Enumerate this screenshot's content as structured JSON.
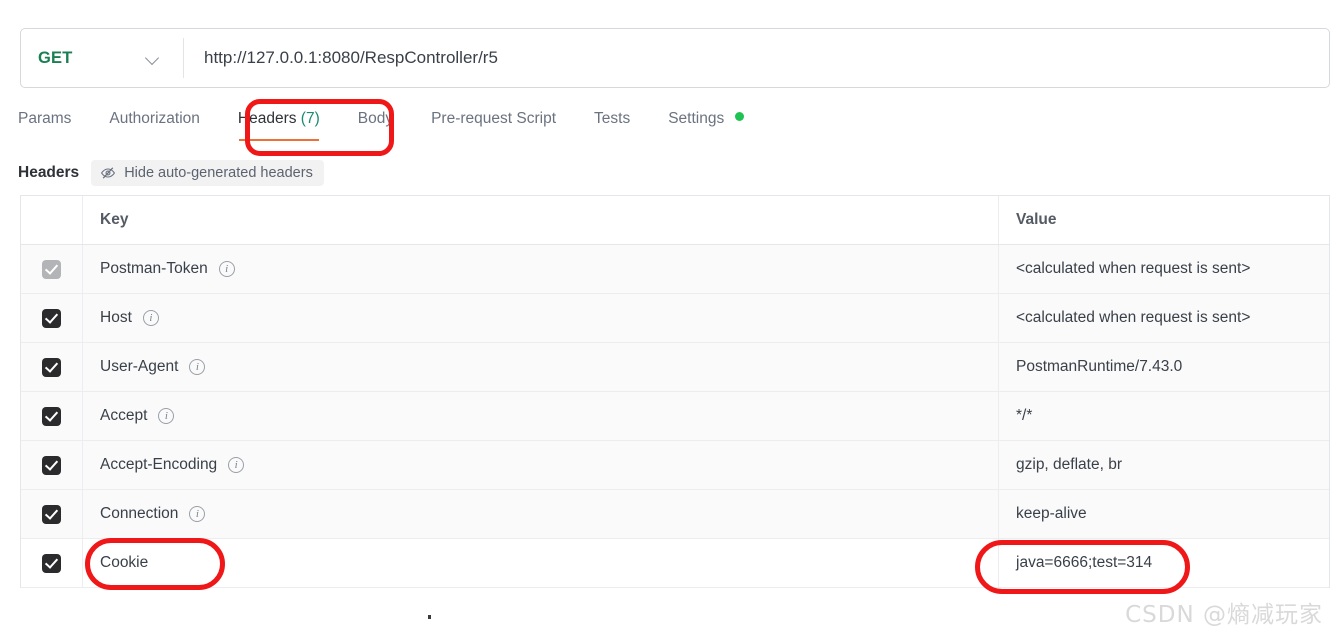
{
  "request_bar": {
    "method": "GET",
    "method_dropdown_icon": "chevron-down-icon",
    "url": "http://127.0.0.1:8080/RespController/r5"
  },
  "tabs": [
    {
      "label": "Params",
      "active": false
    },
    {
      "label": "Authorization",
      "active": false
    },
    {
      "label": "Headers",
      "count": "(7)",
      "active": true
    },
    {
      "label": "Body",
      "active": false
    },
    {
      "label": "Pre-request Script",
      "active": false
    },
    {
      "label": "Tests",
      "active": false
    },
    {
      "label": "Settings",
      "active": false,
      "dot": true
    }
  ],
  "subbar": {
    "title": "Headers",
    "hide_button_label": "Hide auto-generated headers",
    "hide_button_icon": "eye-slash-icon"
  },
  "table": {
    "columns": [
      "Key",
      "Value"
    ],
    "rows": [
      {
        "checked": true,
        "disabled": true,
        "auto_generated": true,
        "key": "Postman-Token",
        "has_info": true,
        "value": "<calculated when request is sent>"
      },
      {
        "checked": true,
        "disabled": false,
        "auto_generated": true,
        "key": "Host",
        "has_info": true,
        "value": "<calculated when request is sent>"
      },
      {
        "checked": true,
        "disabled": false,
        "auto_generated": true,
        "key": "User-Agent",
        "has_info": true,
        "value": "PostmanRuntime/7.43.0"
      },
      {
        "checked": true,
        "disabled": false,
        "auto_generated": true,
        "key": "Accept",
        "has_info": true,
        "value": "*/*"
      },
      {
        "checked": true,
        "disabled": false,
        "auto_generated": true,
        "key": "Accept-Encoding",
        "has_info": true,
        "value": "gzip, deflate, br"
      },
      {
        "checked": true,
        "disabled": false,
        "auto_generated": true,
        "key": "Connection",
        "has_info": true,
        "value": "keep-alive"
      },
      {
        "checked": true,
        "disabled": false,
        "auto_generated": false,
        "key": "Cookie",
        "has_info": false,
        "value": "java=6666;test=314"
      }
    ]
  },
  "watermark": "CSDN @熵减玩家",
  "colors": {
    "method_green": "#1a7f52",
    "tab_active_underline": "#ef7036",
    "count_teal": "#1c8a72",
    "settings_dot_green": "#20c352",
    "annotation_red": "#ef1717",
    "checkbox_dark": "#2b2b2d",
    "checkbox_disabled": "#b3b4b7",
    "auto_row_bg": "#fafafa"
  }
}
